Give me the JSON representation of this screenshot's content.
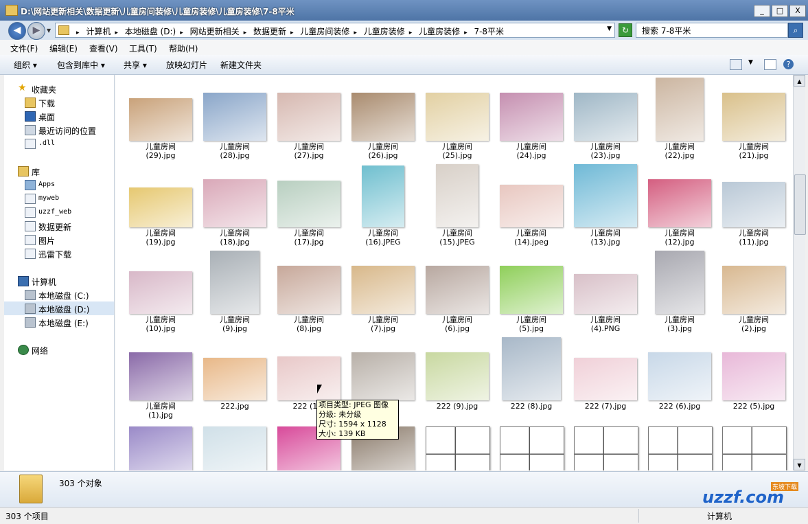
{
  "window": {
    "title": "D:\\网站更新相关\\数据更新\\儿童房间装修\\儿童房装修\\儿童房装修\\7-8平米",
    "minimize": "_",
    "maximize": "□",
    "close": "X"
  },
  "address": {
    "crumbs": [
      "计算机",
      "本地磁盘 (D:)",
      "网站更新相关",
      "数据更新",
      "儿童房间装修",
      "儿童房装修",
      "儿童房装修",
      "7-8平米"
    ],
    "search_value": "搜索 7-8平米"
  },
  "menu": [
    "文件(F)",
    "编辑(E)",
    "查看(V)",
    "工具(T)",
    "帮助(H)"
  ],
  "toolbar": {
    "organize": "组织 ▾",
    "include": "包含到库中 ▾",
    "share": "共享 ▾",
    "slideshow": "放映幻灯片",
    "new_folder": "新建文件夹"
  },
  "nav": {
    "favorites": "收藏夹",
    "downloads": "下载",
    "desktop": "桌面",
    "recent": "最近访问的位置",
    "dll": ".dll",
    "libraries": "库",
    "apps": "Apps",
    "myweb": "myweb",
    "uzzf_web": "uzzf_web",
    "data_update": "数据更新",
    "pictures": "图片",
    "thunder": "迅雷下载",
    "computer": "计算机",
    "disk_c": "本地磁盘 (C:)",
    "disk_d": "本地磁盘 (D:)",
    "disk_e": "本地磁盘 (E:)",
    "network": "网络"
  },
  "files": [
    [
      "儿童房间",
      "(29).jpg"
    ],
    [
      "儿童房间",
      "(28).jpg"
    ],
    [
      "儿童房间",
      "(27).jpg"
    ],
    [
      "儿童房间",
      "(26).jpg"
    ],
    [
      "儿童房间",
      "(25).jpg"
    ],
    [
      "儿童房间",
      "(24).jpg"
    ],
    [
      "儿童房间",
      "(23).jpg"
    ],
    [
      "儿童房间",
      "(22).jpg"
    ],
    [
      "儿童房间",
      "(21).jpg"
    ],
    [
      "儿童房间",
      "(19).jpg"
    ],
    [
      "儿童房间",
      "(18).jpg"
    ],
    [
      "儿童房间",
      "(17).jpg"
    ],
    [
      "儿童房间",
      "(16).JPEG"
    ],
    [
      "儿童房间",
      "(15).JPEG"
    ],
    [
      "儿童房间",
      "(14).jpeg"
    ],
    [
      "儿童房间",
      "(13).jpg"
    ],
    [
      "儿童房间",
      "(12).jpg"
    ],
    [
      "儿童房间",
      "(11).jpg"
    ],
    [
      "儿童房间",
      "(10).jpg"
    ],
    [
      "儿童房间",
      "(9).jpg"
    ],
    [
      "儿童房间",
      "(8).jpg"
    ],
    [
      "儿童房间",
      "(7).jpg"
    ],
    [
      "儿童房间",
      "(6).jpg"
    ],
    [
      "儿童房间",
      "(5).jpg"
    ],
    [
      "儿童房间",
      "(4).PNG"
    ],
    [
      "儿童房间",
      "(3).jpg"
    ],
    [
      "儿童房间",
      "(2).jpg"
    ],
    [
      "儿童房间",
      "(1).jpg"
    ],
    [
      "222.jpg",
      ""
    ],
    [
      "222 (11)",
      ""
    ],
    [
      "",
      ""
    ],
    [
      "222 (9).jpg",
      ""
    ],
    [
      "222 (8).jpg",
      ""
    ],
    [
      "222 (7).jpg",
      ""
    ],
    [
      "222 (6).jpg",
      ""
    ],
    [
      "222 (5).jpg",
      ""
    ],
    [
      "",
      ""
    ],
    [
      "",
      ""
    ],
    [
      "",
      ""
    ],
    [
      "",
      ""
    ],
    [
      "",
      ""
    ],
    [
      "",
      ""
    ],
    [
      "",
      ""
    ],
    [
      "",
      ""
    ],
    [
      "",
      ""
    ]
  ],
  "tooltip": {
    "type": "项目类型: JPEG 图像",
    "rating": "分级: 未分级",
    "size": "尺寸: 1594 x 1128",
    "filesize": "大小: 139 KB"
  },
  "details": {
    "count": "303 个对象"
  },
  "status": {
    "left": "303 个项目",
    "right": "计算机"
  },
  "logo": {
    "text": "uzzf.com",
    "tag": "东坡下载"
  }
}
